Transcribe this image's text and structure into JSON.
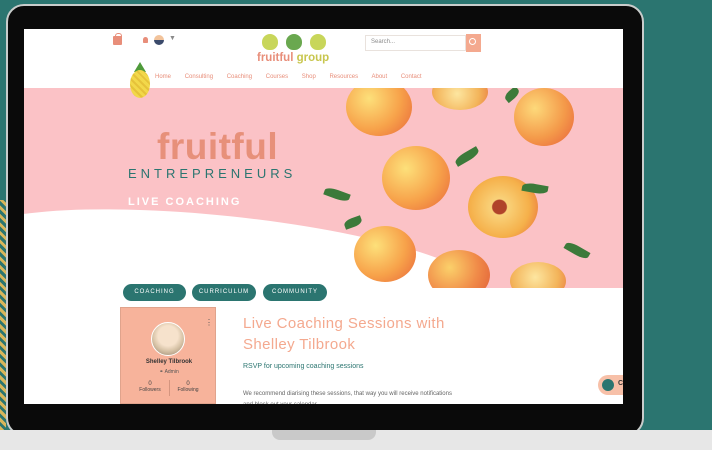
{
  "header": {
    "logo_text_1": "fruitful",
    "logo_text_2": "group",
    "search_placeholder": "Search..."
  },
  "nav": [
    "Home",
    "Consulting",
    "Coaching",
    "Courses",
    "Shop",
    "Resources",
    "About",
    "Contact"
  ],
  "hero": {
    "brand_word": "fruitful",
    "brand_sub": "ENTREPRENEURS",
    "tagline": "LIVE COACHING"
  },
  "pills": [
    "COACHING",
    "CURRICULUM",
    "COMMUNITY"
  ],
  "profile": {
    "name": "Shelley Tilbrook",
    "role": "Admin",
    "followers_count": "0",
    "followers_label": "Followers",
    "following_count": "0",
    "following_label": "Following"
  },
  "content": {
    "title": "Live Coaching Sessions with Shelley Tilbrook",
    "rsvp": "RSVP for upcoming coaching sessions",
    "body": "We recommend diarising these sessions, that way you will receive notifications and block out your calendar."
  },
  "chat": {
    "label": "C"
  },
  "colors": {
    "teal": "#2b7570",
    "salmon": "#e88e7a",
    "hero_pink": "#fbc2c6",
    "card_peach": "#f7b39b"
  }
}
